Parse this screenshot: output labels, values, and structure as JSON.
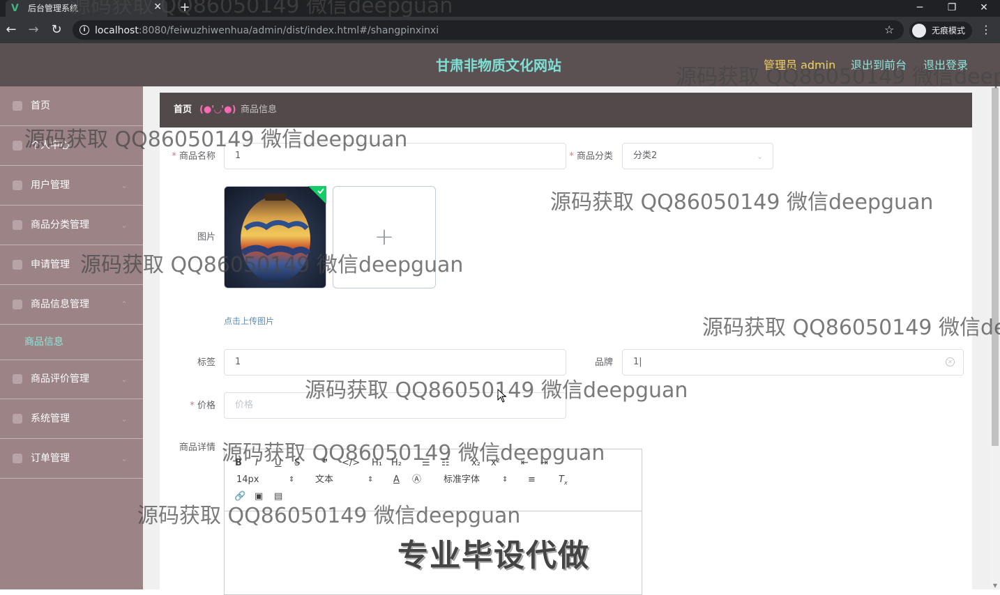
{
  "browser": {
    "tab_title": "后台管理系统",
    "url_host": "localhost",
    "url_rest": ":8080/feiwuzhiwenhua/admin/dist/index.html#/shangpinxinxi",
    "incognito_label": "无痕模式"
  },
  "header": {
    "site_title": "甘肃非物质文化网站",
    "admin_label": "管理员 admin",
    "to_front": "退出到前台",
    "logout": "退出登录"
  },
  "sidebar": {
    "items": [
      {
        "label": "首页"
      },
      {
        "label": "个人中心"
      },
      {
        "label": "用户管理"
      },
      {
        "label": "商品分类管理"
      },
      {
        "label": "申请管理"
      },
      {
        "label": "商品信息管理"
      },
      {
        "label": "商品评价管理"
      },
      {
        "label": "系统管理"
      },
      {
        "label": "订单管理"
      }
    ],
    "active_sub": "商品信息"
  },
  "breadcrumb": {
    "home": "首页",
    "separator": "(●'◡'●)",
    "current": "商品信息"
  },
  "form": {
    "name_label": "商品名称",
    "name_value": "1",
    "category_label": "商品分类",
    "category_value": "分类2",
    "image_label": "图片",
    "upload_tip": "点击上传图片",
    "tag_label": "标签",
    "tag_value": "1",
    "brand_label": "品牌",
    "brand_value": "1|",
    "price_label": "价格",
    "price_placeholder": "价格",
    "detail_label": "商品详情"
  },
  "editor": {
    "font_size": "14px",
    "text_type": "文本",
    "font_family": "标准字体"
  },
  "overlays": {
    "watermark": "源码获取 QQ86050149 微信deepguan",
    "watermark_cut1": "源码获取 QQ86050149 微信deep",
    "watermark_cut2": "源码获取 QQ86050149 微信de",
    "stamp": "专业毕设代做"
  },
  "colors": {
    "header_bg": "#5b5153",
    "sidebar_bg": "#9b8386",
    "title_accent": "#7fe0d6",
    "admin_accent": "#f4d35e",
    "required": "#f56c6c"
  }
}
